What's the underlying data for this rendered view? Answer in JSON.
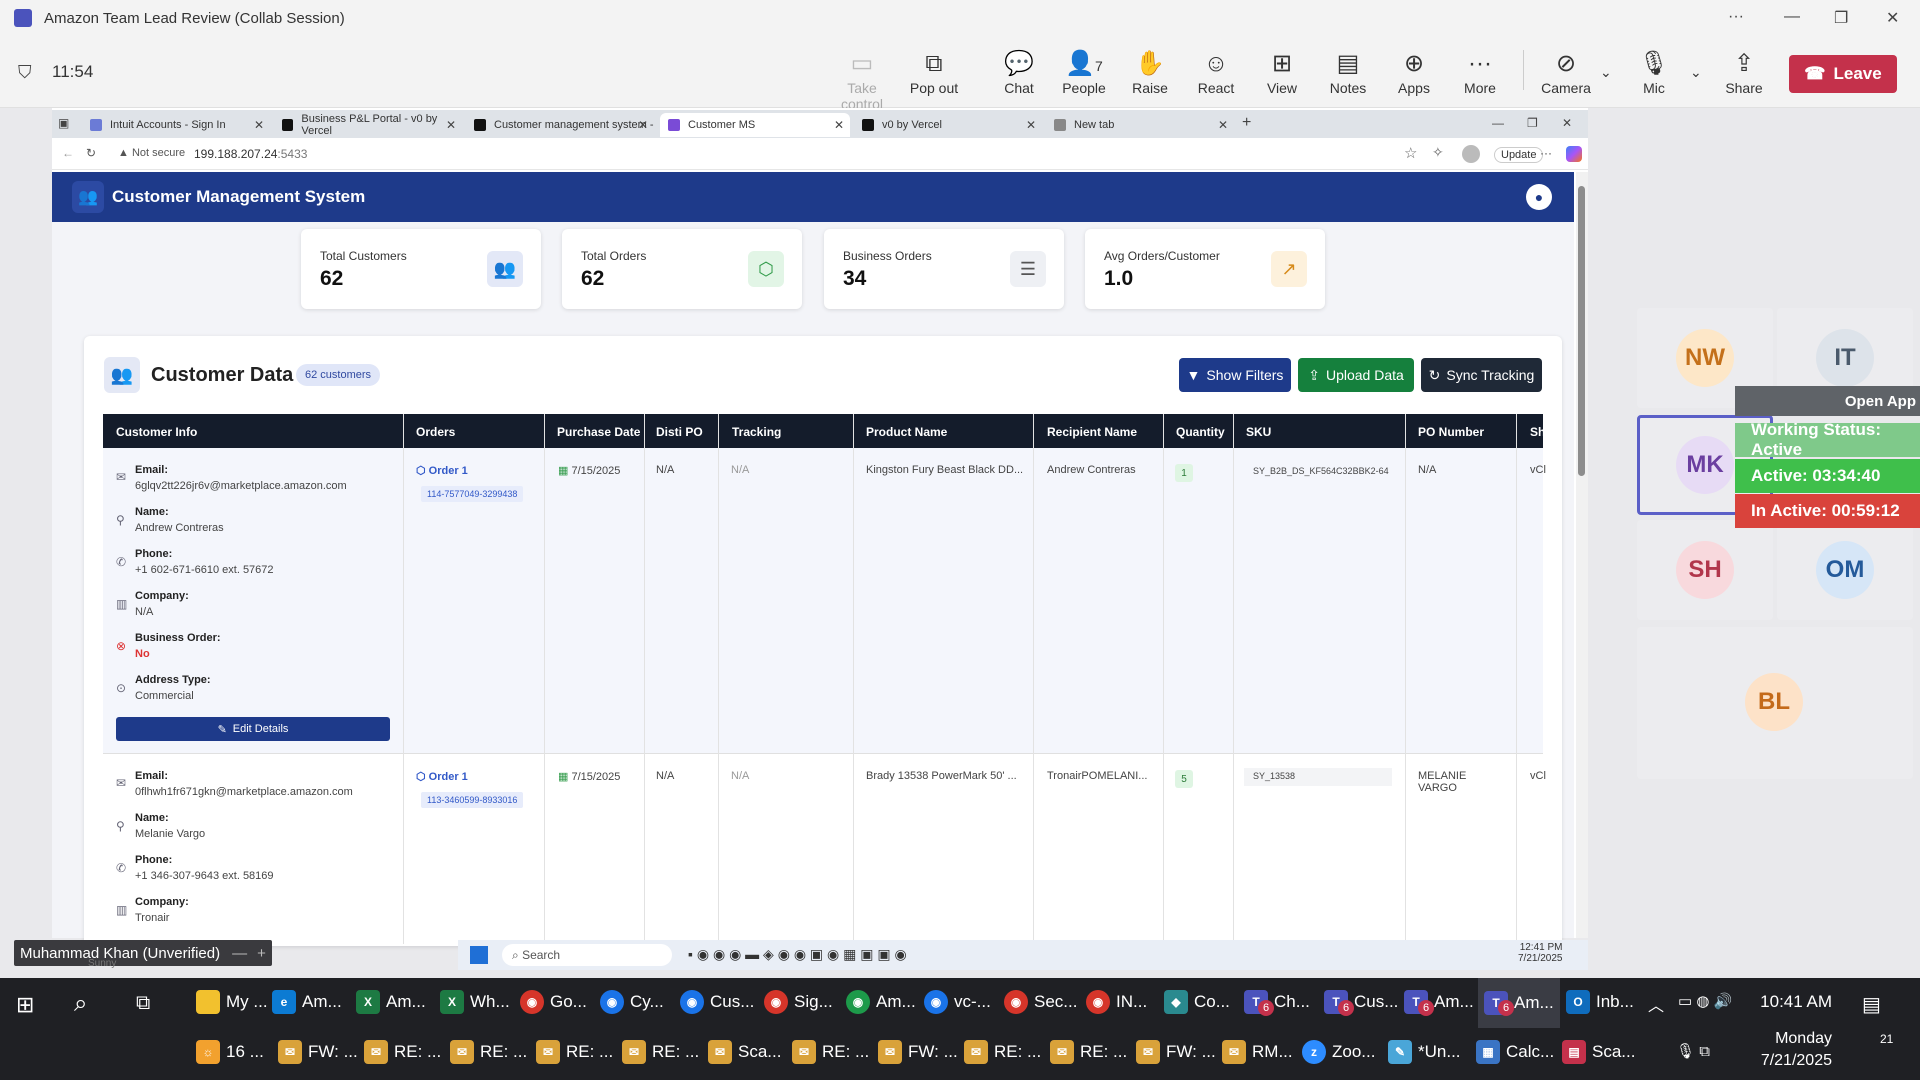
{
  "meeting": {
    "title": "Amazon Team Lead Review (Collab Session)",
    "window_controls": [
      "···",
      "—",
      "❐",
      "✕"
    ],
    "timer": "11:54",
    "toolbar": [
      {
        "label": "Take control",
        "icon": "take-control-icon",
        "disabled": true
      },
      {
        "label": "Pop out",
        "icon": "pop-out-icon"
      },
      {
        "label": "Chat",
        "icon": "chat-icon"
      },
      {
        "label": "People",
        "icon": "people-icon",
        "count": "7"
      },
      {
        "label": "Raise",
        "icon": "raise-hand-icon"
      },
      {
        "label": "React",
        "icon": "react-icon"
      },
      {
        "label": "View",
        "icon": "view-icon"
      },
      {
        "label": "Notes",
        "icon": "notes-icon"
      },
      {
        "label": "Apps",
        "icon": "apps-icon"
      },
      {
        "label": "More",
        "icon": "more-icon"
      },
      {
        "label": "Camera",
        "icon": "camera-off-icon"
      },
      {
        "label": "Mic",
        "icon": "mic-icon"
      },
      {
        "label": "Share",
        "icon": "share-icon"
      }
    ],
    "leave_label": "Leave",
    "presenter_label": "Muhammad Khan (Unverified)",
    "presenter_sub": "Sunny",
    "participants": [
      "NW",
      "IT",
      "MK",
      "SH",
      "OM",
      "BL"
    ],
    "open_app_label": "Open App",
    "status_overlay": {
      "working": "Working Status: Active",
      "active": "Active: 03:34:40",
      "inactive": "In Active: 00:59:12"
    },
    "accent": "#c4314b"
  },
  "browser": {
    "tabs": [
      "Intuit Accounts - Sign In",
      "Business P&L Portal - v0 by Vercel",
      "Customer management system -",
      "Customer MS",
      "v0 by Vercel",
      "New tab"
    ],
    "address_security": "Not secure",
    "address_host": "199.188.207.24",
    "address_port": ":5433",
    "update_label": "Update"
  },
  "app": {
    "title": "Customer Management System",
    "brand_color": "#1e3a8a",
    "stats": [
      {
        "label": "Total Customers",
        "value": "62",
        "icon": "users-icon"
      },
      {
        "label": "Total Orders",
        "value": "62",
        "icon": "box-icon"
      },
      {
        "label": "Business Orders",
        "value": "34",
        "icon": "database-icon"
      },
      {
        "label": "Avg Orders/Customer",
        "value": "1.0",
        "icon": "trend-up-icon"
      }
    ],
    "section_title": "Customer Data",
    "customer_count": "62 customers",
    "buttons": {
      "filters": "Show Filters",
      "upload": "Upload Data",
      "sync": "Sync Tracking"
    },
    "columns": [
      "Customer Info",
      "Orders",
      "Purchase Date",
      "Disti PO",
      "Tracking",
      "Product Name",
      "Recipient Name",
      "Quantity",
      "SKU",
      "PO Number",
      "Sh"
    ],
    "field_labels": {
      "email": "Email:",
      "name": "Name:",
      "phone": "Phone:",
      "company": "Company:",
      "business": "Business Order:",
      "address": "Address Type:"
    },
    "edit_label": "Edit Details",
    "rows": [
      {
        "email": "6glqv2tt226jr6v@marketplace.amazon.com",
        "name": "Andrew Contreras",
        "phone": "+1 602-671-6610 ext. 57672",
        "company": "N/A",
        "business": "No",
        "address": "Commercial",
        "order": "Order 1",
        "order_id": "114-7577049-3299438",
        "date": "7/15/2025",
        "disti": "N/A",
        "tracking": "N/A",
        "product": "Kingston Fury Beast Black DD...",
        "recipient": "Andrew Contreras",
        "qty": "1",
        "sku": "SY_B2B_DS_KF564C32BBK2-64",
        "po": "N/A",
        "ship": "vCl"
      },
      {
        "email": "0flhwh1fr671gkn@marketplace.amazon.com",
        "name": "Melanie Vargo",
        "phone": "+1 346-307-9643 ext. 58169",
        "company": "Tronair",
        "order": "Order 1",
        "order_id": "113-3460599-8933016",
        "date": "7/15/2025",
        "disti": "N/A",
        "tracking": "N/A",
        "product": "Brady 13538 PowerMark 50' ...",
        "recipient": "TronairPOMELANI...",
        "qty": "5",
        "sku": "SY_13538",
        "po": "MELANIE VARGO",
        "ship": "vCl"
      }
    ]
  },
  "vm": {
    "search": "Search",
    "time": "12:41 PM",
    "date": "7/21/2025"
  },
  "taskbar": {
    "row1": [
      "My ...",
      "Am...",
      "Am...",
      "Wh...",
      "Go...",
      "Cy...",
      "Cus...",
      "Sig...",
      "Am...",
      "vc-...",
      "Sec...",
      "IN...",
      "Co...",
      "Ch...",
      "Cus...",
      "Am...",
      "Am...",
      "Inb..."
    ],
    "row2": [
      "16 ...",
      "FW: ...",
      "RE: ...",
      "RE: ...",
      "RE: ...",
      "RE: ...",
      "Sca...",
      "RE: ...",
      "FW: ...",
      "RE: ...",
      "RE: ...",
      "FW: ...",
      "RM...",
      "Zoo...",
      "*Un...",
      "Calc...",
      "Sca..."
    ],
    "badge": "6",
    "clock_time": "10:41 AM",
    "clock_day": "Monday",
    "clock_date": "7/21/2025",
    "notif_count": "21"
  }
}
